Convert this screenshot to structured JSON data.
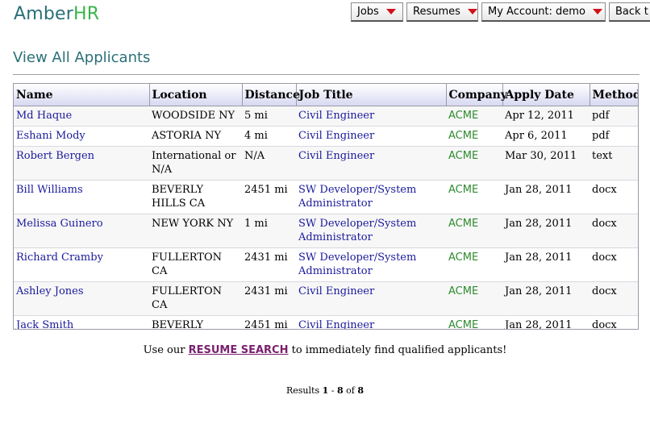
{
  "brand": {
    "part1": "Amber",
    "part2": "HR"
  },
  "nav": [
    {
      "label": "Jobs",
      "has_dropdown": true
    },
    {
      "label": "Resumes",
      "has_dropdown": true
    },
    {
      "label": "My Account: demo",
      "has_dropdown": true
    },
    {
      "label": "Back t",
      "has_dropdown": false
    }
  ],
  "page": {
    "title": "View All Applicants"
  },
  "table": {
    "headers": [
      "Name",
      "Location",
      "Distance",
      "Job Title",
      "Company",
      "Apply Date",
      "Method"
    ],
    "rows": [
      {
        "name": "Md Haque",
        "location": "WOODSIDE NY",
        "distance": "5 mi",
        "job_title": "Civil Engineer",
        "company": "ACME",
        "apply_date": "Apr 12, 2011",
        "method": "pdf"
      },
      {
        "name": "Eshani Mody",
        "location": "ASTORIA NY",
        "distance": "4 mi",
        "job_title": "Civil Engineer",
        "company": "ACME",
        "apply_date": "Apr 6, 2011",
        "method": "pdf"
      },
      {
        "name": "Robert Bergen",
        "location": "International or N/A",
        "distance": "N/A",
        "job_title": "Civil Engineer",
        "company": "ACME",
        "apply_date": "Mar 30, 2011",
        "method": "text"
      },
      {
        "name": "Bill Williams",
        "location": "BEVERLY HILLS CA",
        "distance": "2451 mi",
        "job_title": "SW Developer/System Administrator",
        "company": "ACME",
        "apply_date": "Jan 28, 2011",
        "method": "docx"
      },
      {
        "name": "Melissa Guinero",
        "location": "NEW YORK NY",
        "distance": "1 mi",
        "job_title": "SW Developer/System Administrator",
        "company": "ACME",
        "apply_date": "Jan 28, 2011",
        "method": "docx"
      },
      {
        "name": "Richard Cramby",
        "location": "FULLERTON CA",
        "distance": "2431 mi",
        "job_title": "SW Developer/System Administrator",
        "company": "ACME",
        "apply_date": "Jan 28, 2011",
        "method": "docx"
      },
      {
        "name": "Ashley Jones",
        "location": "FULLERTON CA",
        "distance": "2431 mi",
        "job_title": "Civil Engineer",
        "company": "ACME",
        "apply_date": "Jan 28, 2011",
        "method": "docx"
      },
      {
        "name": "Jack Smith",
        "location": "BEVERLY HILLS CA",
        "distance": "2451 mi",
        "job_title": "Civil Engineer",
        "company": "ACME",
        "apply_date": "Jan 28, 2011",
        "method": "docx"
      }
    ]
  },
  "promo": {
    "before": "Use our ",
    "link": "RESUME SEARCH",
    "after": " to immediately find qualified applicants!"
  },
  "results": {
    "prefix": "Results ",
    "start": "1",
    "sep": " - ",
    "end": "8",
    "of": " of ",
    "total": "8"
  },
  "colors": {
    "brand_teal": "#2a6f78",
    "brand_green": "#39b54a",
    "link": "#1a1a9c",
    "company": "#2e8b2e",
    "nav_arrow": "#d0101a"
  }
}
